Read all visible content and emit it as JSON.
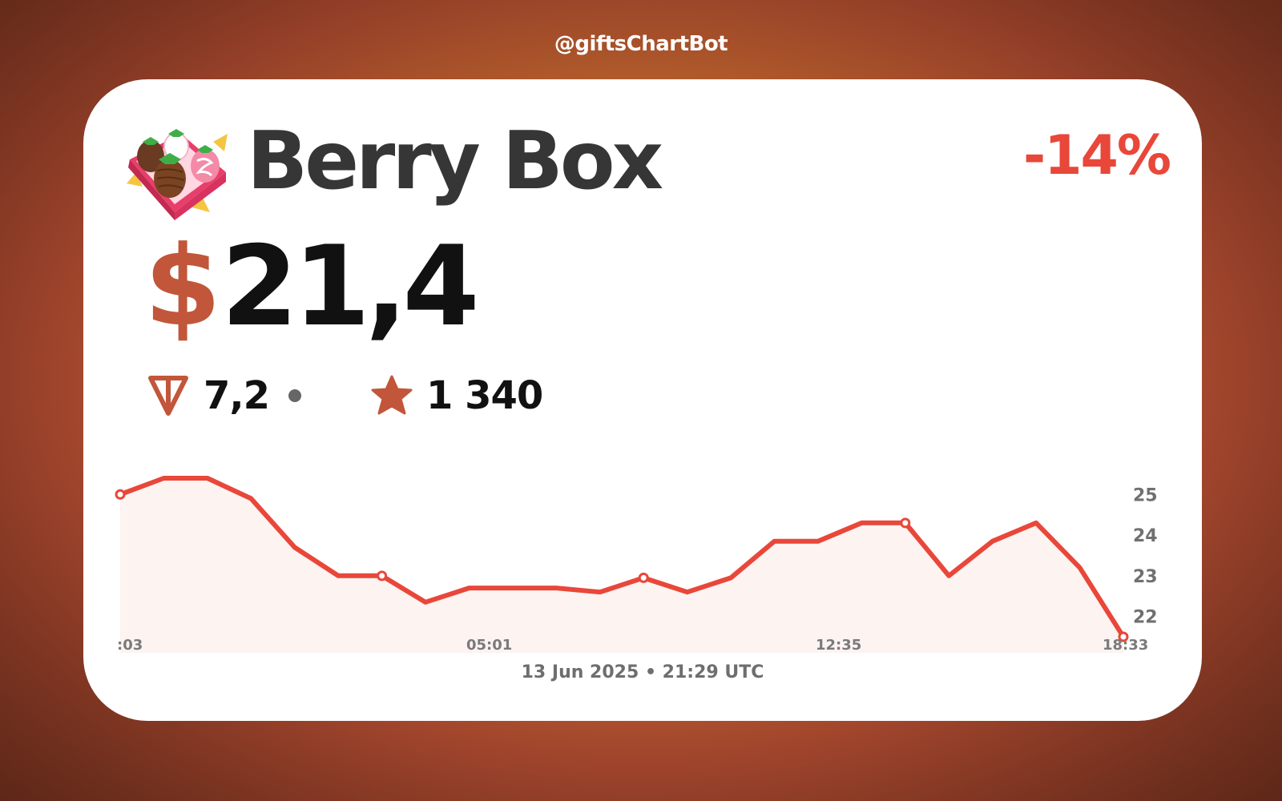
{
  "header": {
    "handle": "@giftsChartBot"
  },
  "gift": {
    "name": "Berry Box",
    "icon": "berry-box-gift-icon",
    "change": "-14%",
    "currency_symbol": "$",
    "price": "21,4",
    "ton_value": "7,2",
    "stars_value": "1 340"
  },
  "colors": {
    "accent": "#c2563a",
    "negative": "#e8473a",
    "line": "#e8473a",
    "fill": "#fdf3f1"
  },
  "chart_data": {
    "type": "area",
    "x_tick_labels": [
      ":03",
      "05:01",
      "12:35",
      "18:33"
    ],
    "y_tick_labels": [
      "25",
      "24",
      "23",
      "22"
    ],
    "ylim": [
      21.5,
      25.4
    ],
    "values": [
      25.0,
      25.4,
      25.4,
      24.9,
      23.7,
      23.0,
      23.0,
      22.35,
      22.7,
      22.7,
      22.7,
      22.6,
      22.95,
      22.6,
      22.95,
      23.85,
      23.85,
      24.3,
      24.3,
      23.0,
      23.85,
      24.3,
      23.2,
      21.5
    ],
    "marked_points": [
      0,
      6,
      12,
      18,
      23
    ],
    "grid": false,
    "legend": "none"
  },
  "footer": {
    "timestamp": "13 Jun 2025 • 21:29 UTC"
  }
}
